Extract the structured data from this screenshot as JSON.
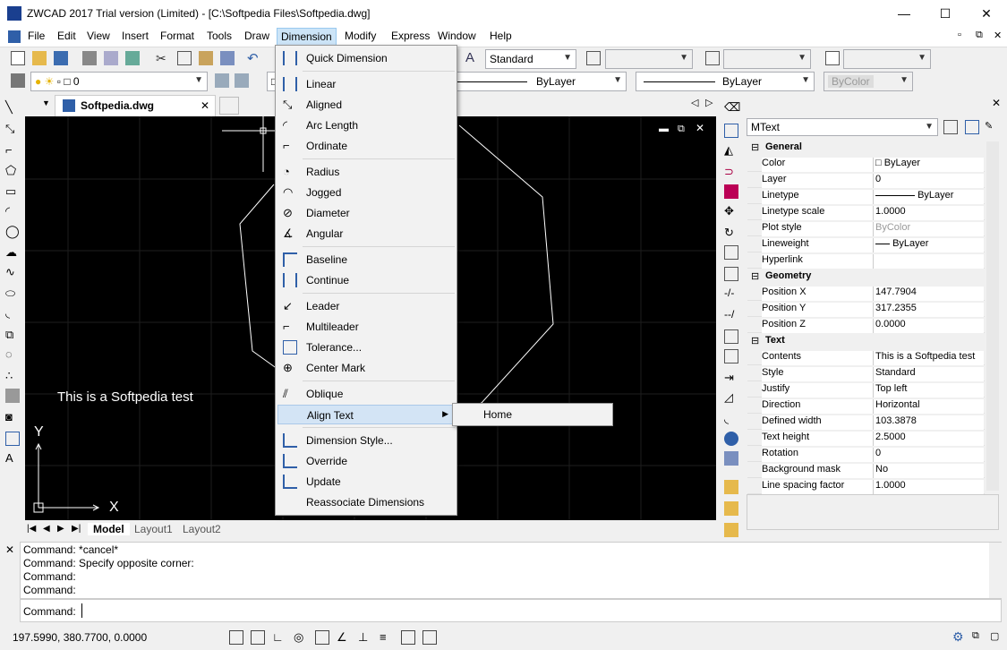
{
  "window": {
    "title": "ZWCAD 2017 Trial version (Limited) - [C:\\Softpedia Files\\Softpedia.dwg]",
    "min": "—",
    "max": "☐",
    "close": "✕"
  },
  "menubar": {
    "items": [
      "File",
      "Edit",
      "View",
      "Insert",
      "Format",
      "Tools",
      "Draw",
      "Dimension",
      "Modify",
      "Express",
      "Window",
      "Help"
    ]
  },
  "toolbar": {
    "text_style": "Standard",
    "layer": "0",
    "linetype": "ByLayer",
    "lineweight": "ByLayer",
    "plotstyle": "ByColor"
  },
  "doc_tab": {
    "name": "Softpedia.dwg"
  },
  "canvas": {
    "text": "This is a Softpedia test",
    "axis_y": "Y",
    "axis_x": "X"
  },
  "layout_tabs": [
    "Model",
    "Layout1",
    "Layout2"
  ],
  "dimension_menu": {
    "items": [
      {
        "label": "Quick Dimension",
        "icon": "quick-dimension-icon"
      },
      {
        "label": "Linear",
        "icon": "linear-icon"
      },
      {
        "label": "Aligned",
        "icon": "aligned-icon"
      },
      {
        "label": "Arc Length",
        "icon": "arc-length-icon"
      },
      {
        "label": "Ordinate",
        "icon": "ordinate-icon"
      },
      {
        "label": "Radius",
        "icon": "radius-icon"
      },
      {
        "label": "Jogged",
        "icon": "jogged-icon"
      },
      {
        "label": "Diameter",
        "icon": "diameter-icon"
      },
      {
        "label": "Angular",
        "icon": "angular-icon"
      },
      {
        "label": "Baseline",
        "icon": "baseline-icon"
      },
      {
        "label": "Continue",
        "icon": "continue-icon"
      },
      {
        "label": "Leader",
        "icon": "leader-icon"
      },
      {
        "label": "Multileader",
        "icon": "multileader-icon"
      },
      {
        "label": "Tolerance...",
        "icon": "tolerance-icon"
      },
      {
        "label": "Center Mark",
        "icon": "center-mark-icon"
      },
      {
        "label": "Oblique",
        "icon": "oblique-icon"
      },
      {
        "label": "Align Text",
        "icon": ""
      },
      {
        "label": "Dimension Style...",
        "icon": "dimension-style-icon"
      },
      {
        "label": "Override",
        "icon": "override-icon"
      },
      {
        "label": "Update",
        "icon": "update-icon"
      },
      {
        "label": "Reassociate Dimensions",
        "icon": ""
      }
    ],
    "submenu": [
      "Home"
    ]
  },
  "properties": {
    "selector": "MText",
    "groups": {
      "general": "General",
      "geometry": "Geometry",
      "text": "Text"
    },
    "general": [
      [
        "Color",
        "ByLayer"
      ],
      [
        "Layer",
        "0"
      ],
      [
        "Linetype",
        "ByLayer"
      ],
      [
        "Linetype scale",
        "1.0000"
      ],
      [
        "Plot style",
        "ByColor"
      ],
      [
        "Lineweight",
        "ByLayer"
      ],
      [
        "Hyperlink",
        ""
      ]
    ],
    "geometry": [
      [
        "Position X",
        "147.7904"
      ],
      [
        "Position Y",
        "317.2355"
      ],
      [
        "Position Z",
        "0.0000"
      ]
    ],
    "text": [
      [
        "Contents",
        "This is a Softpedia test"
      ],
      [
        "Style",
        "Standard"
      ],
      [
        "Justify",
        "Top left"
      ],
      [
        "Direction",
        "Horizontal"
      ],
      [
        "Defined width",
        "103.3878"
      ],
      [
        "Text height",
        "2.5000"
      ],
      [
        "Rotation",
        "0"
      ],
      [
        "Background mask",
        "No"
      ],
      [
        "Line spacing factor",
        "1.0000"
      ]
    ]
  },
  "command": {
    "lines": [
      "Command: *cancel*",
      "Command: Specify opposite corner:",
      "Command:",
      "Command:"
    ],
    "prompt": "Command:"
  },
  "status": {
    "coords": "197.5990, 380.7700, 0.0000"
  }
}
